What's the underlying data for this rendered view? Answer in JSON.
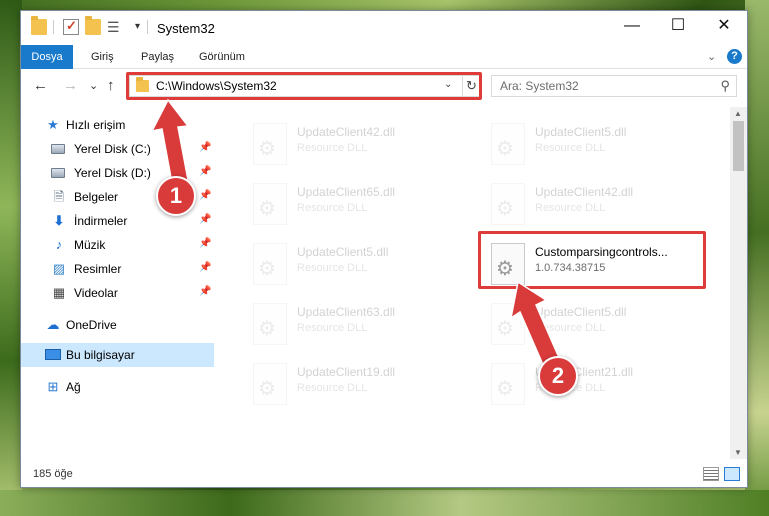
{
  "window": {
    "title": "System32",
    "minimize_glyph": "—",
    "maximize_glyph": "☐",
    "close_glyph": "✕",
    "qa_dropdown_glyph": "▾"
  },
  "ribbon": {
    "tabs": [
      "Dosya",
      "Giriş",
      "Paylaş",
      "Görünüm"
    ],
    "chevron_glyph": "⌄",
    "help_glyph": "?"
  },
  "nav": {
    "back_glyph": "←",
    "forward_glyph": "→",
    "recent_glyph": "⌄",
    "up_glyph": "↑"
  },
  "address": {
    "path": "C:\\Windows\\System32",
    "dropdown_glyph": "⌄",
    "refresh_glyph": "↻"
  },
  "search": {
    "placeholder": "Ara: System32",
    "icon_glyph": "⚲"
  },
  "sidebar": {
    "pin_glyph": "📌",
    "items": [
      {
        "label": "Hızlı erişim",
        "icon": "star-icon",
        "glyph": "★"
      },
      {
        "label": "Yerel Disk (C:)",
        "icon": "drive-icon",
        "glyph": ""
      },
      {
        "label": "Yerel Disk (D:)",
        "icon": "drive-icon",
        "glyph": ""
      },
      {
        "label": "Belgeler",
        "icon": "documents-icon",
        "glyph": "🗎"
      },
      {
        "label": "İndirmeler",
        "icon": "download-icon",
        "glyph": "⬇"
      },
      {
        "label": "Müzik",
        "icon": "music-icon",
        "glyph": "♪"
      },
      {
        "label": "Resimler",
        "icon": "pictures-icon",
        "glyph": "▨"
      },
      {
        "label": "Videolar",
        "icon": "videos-icon",
        "glyph": "▦"
      },
      {
        "label": "OneDrive",
        "icon": "cloud-icon",
        "glyph": "☁"
      },
      {
        "label": "Bu bilgisayar",
        "icon": "computer-icon",
        "glyph": ""
      },
      {
        "label": "Ağ",
        "icon": "network-icon",
        "glyph": "⊞"
      }
    ]
  },
  "files": [
    {
      "name": "UpdateClient42.dll",
      "sub": "Resource DLL"
    },
    {
      "name": "UpdateClient5.dll",
      "sub": "Resource DLL"
    },
    {
      "name": "UpdateClient65.dll",
      "sub": "Resource DLL"
    },
    {
      "name": "UpdateClient42.dll",
      "sub": "Resource DLL"
    },
    {
      "name": "UpdateClient5.dll",
      "sub": "Resource DLL"
    },
    {
      "name": "Customparsingcontrols...",
      "sub": "1.0.734.38715"
    },
    {
      "name": "UpdateClient63.dll",
      "sub": "Resource DLL"
    },
    {
      "name": "UpdateClient5.dll",
      "sub": "Resource DLL"
    },
    {
      "name": "UpdateClient19.dll",
      "sub": "Resource DLL"
    },
    {
      "name": "UpdateClient21.dll",
      "sub": "Resource DLL"
    }
  ],
  "status": {
    "count": "185 öğe"
  },
  "annotations": {
    "step1": "1",
    "step2": "2",
    "color": "#d93a3a"
  }
}
